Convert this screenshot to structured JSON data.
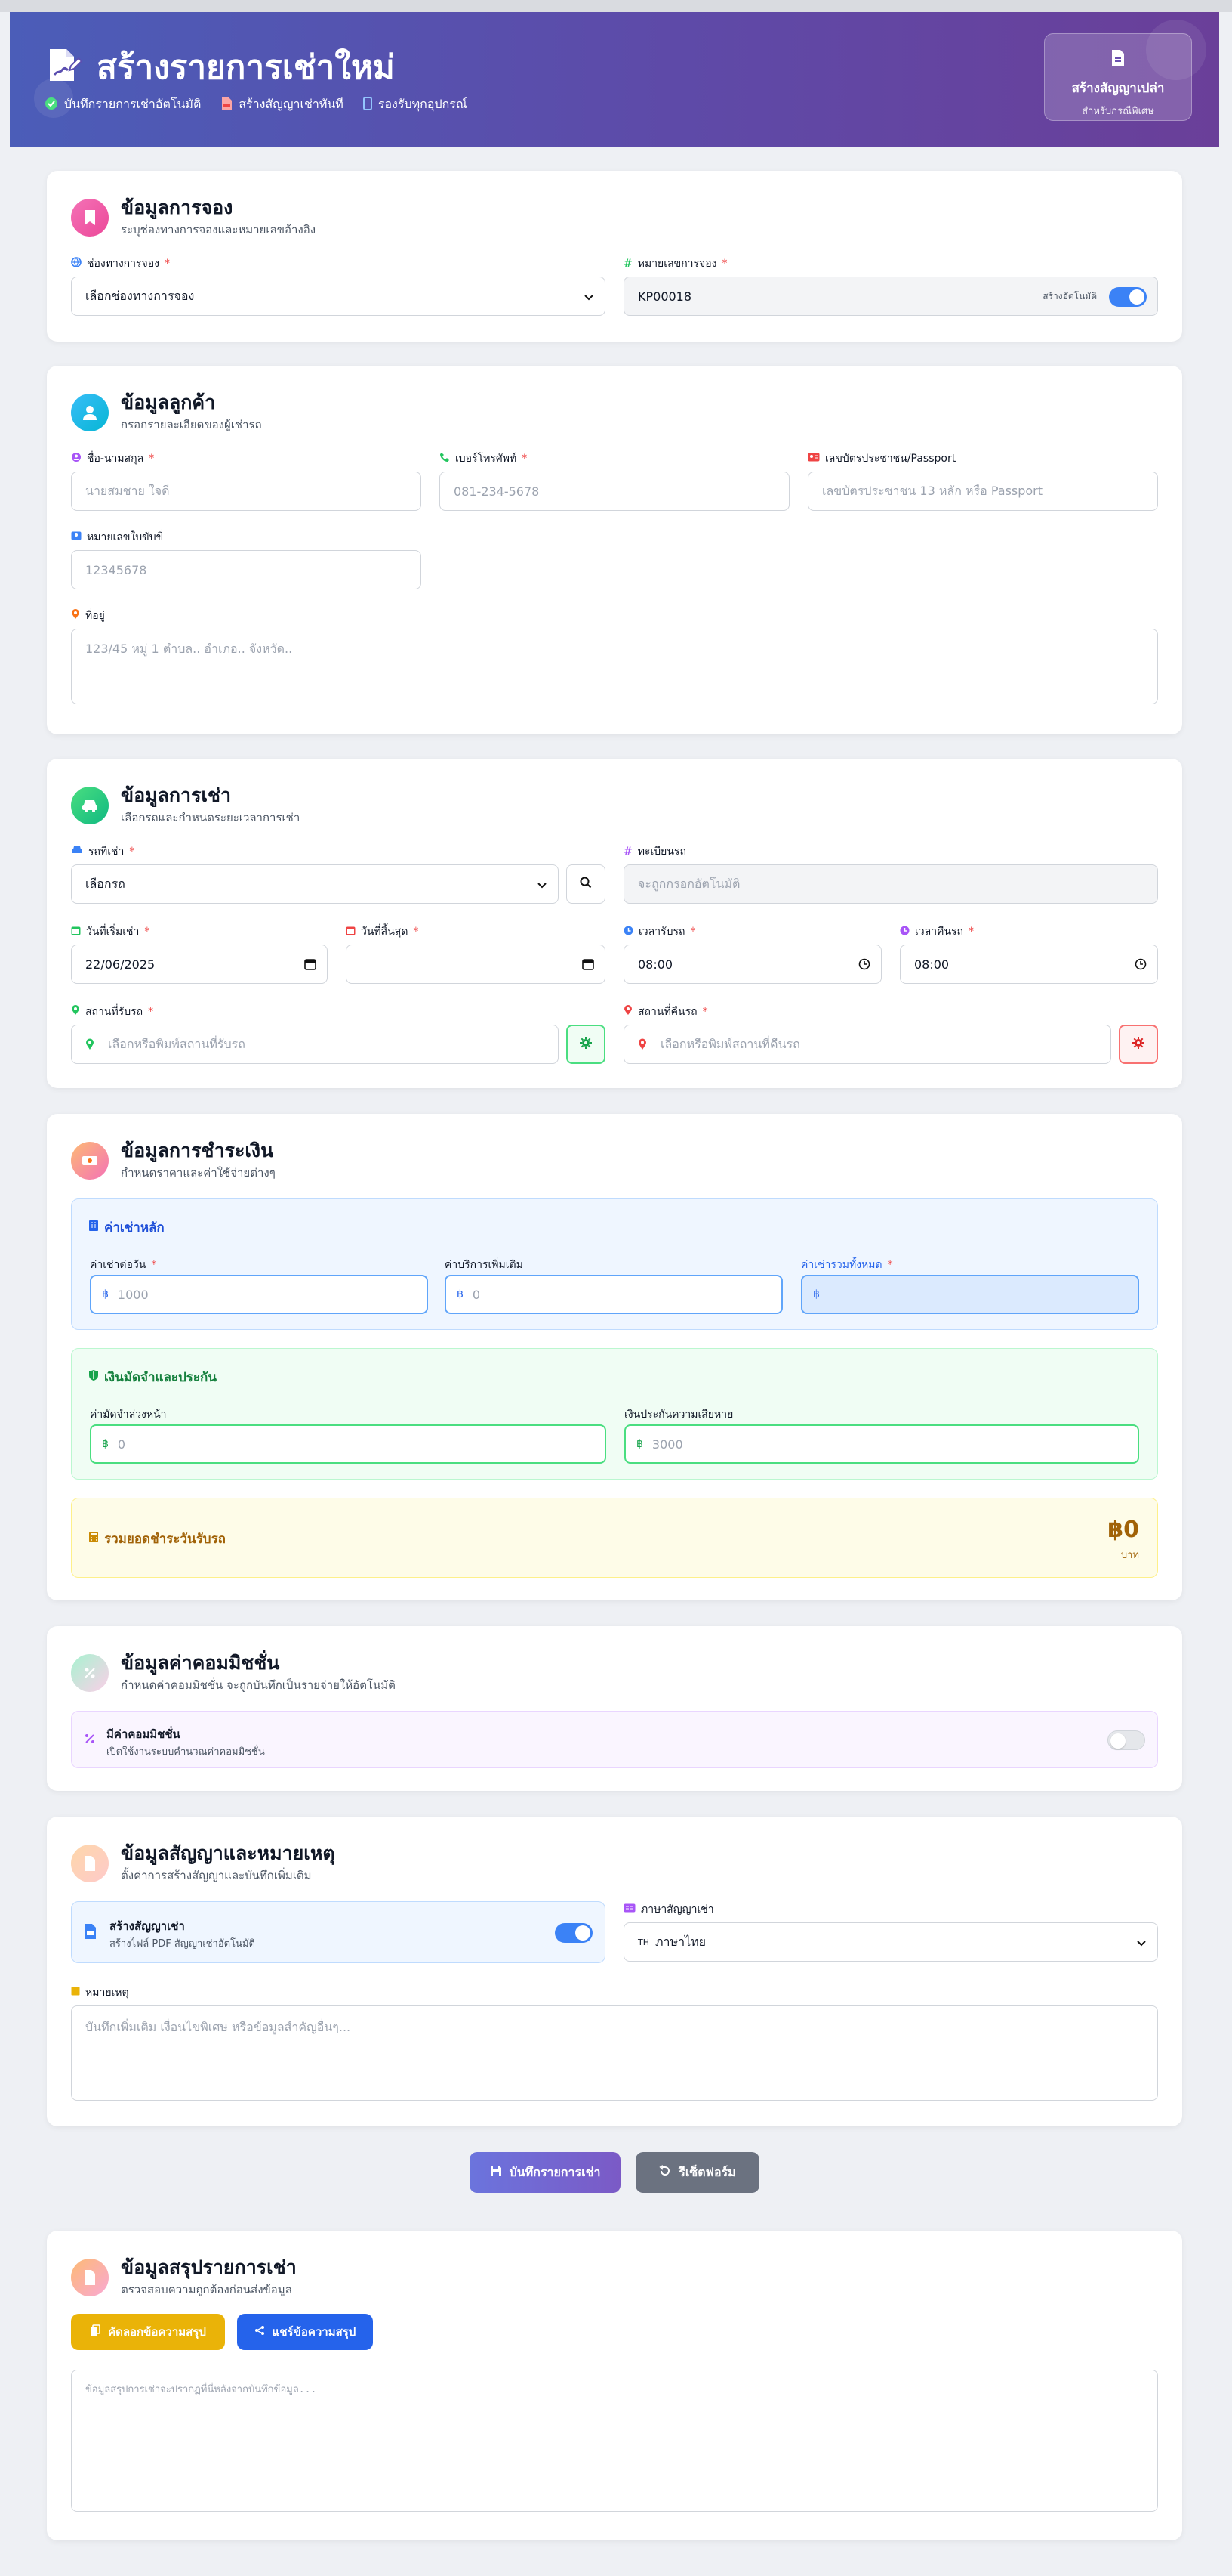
{
  "header": {
    "title": "สร้างรายการเช่าใหม่",
    "subs": [
      "บันทึกรายการเช่าอัตโนมัติ",
      "สร้างสัญญาเช่าทันที",
      "รองรับทุกอุปกรณ์"
    ],
    "blank_contract_title": "สร้างสัญญาเปล่า",
    "blank_contract_sub": "สำหรับกรณีพิเศษ"
  },
  "booking": {
    "title": "ข้อมูลการจอง",
    "subtitle": "ระบุช่องทางการจองและหมายเลขอ้างอิง",
    "channel_label": "ช่องทางการจอง",
    "channel_value": "เลือกช่องทางการจอง",
    "number_label": "หมายเลขการจอง",
    "number_value": "KP00018",
    "auto_label": "สร้างอัตโนมัติ"
  },
  "customer": {
    "title": "ข้อมูลลูกค้า",
    "subtitle": "กรอกรายละเอียดของผู้เช่ารถ",
    "name_label": "ชื่อ-นามสกุล",
    "name_placeholder": "นายสมชาย ใจดี",
    "phone_label": "เบอร์โทรศัพท์",
    "phone_placeholder": "081-234-5678",
    "id_label": "เลขบัตรประชาชน/Passport",
    "id_placeholder": "เลขบัตรประชาชน 13 หลัก หรือ Passport",
    "license_label": "หมายเลขใบขับขี่",
    "license_placeholder": "12345678",
    "address_label": "ที่อยู่",
    "address_placeholder": "123/45 หมู่ 1 ตำบล.. อำเภอ.. จังหวัด.."
  },
  "rental": {
    "title": "ข้อมูลการเช่า",
    "subtitle": "เลือกรถและกำหนดระยะเวลาการเช่า",
    "car_label": "รถที่เช่า",
    "car_value": "เลือกรถ",
    "plate_label": "ทะเบียนรถ",
    "plate_placeholder": "จะถูกกรอกอัตโนมัติ",
    "start_date_label": "วันที่เริ่มเช่า",
    "start_date_value": "22/06/2025",
    "end_date_label": "วันที่สิ้นสุด",
    "pickup_time_label": "เวลารับรถ",
    "pickup_time_value": "08:00",
    "return_time_label": "เวลาคืนรถ",
    "return_time_value": "08:00",
    "pickup_place_label": "สถานที่รับรถ",
    "pickup_place_placeholder": "เลือกหรือพิมพ์สถานที่รับรถ",
    "return_place_label": "สถานที่คืนรถ",
    "return_place_placeholder": "เลือกหรือพิมพ์สถานที่คืนรถ"
  },
  "payment": {
    "title": "ข้อมูลการชำระเงิน",
    "subtitle": "กำหนดราคาและค่าใช้จ่ายต่างๆ",
    "main_title": "ค่าเช่าหลัก",
    "daily_label": "ค่าเช่าต่อวัน",
    "daily_placeholder": "1000",
    "extra_label": "ค่าบริการเพิ่มเติม",
    "extra_placeholder": "0",
    "total_label": "ค่าเช่ารวมทั้งหมด",
    "baht_sign": "฿",
    "deposit_title": "เงินมัดจำและประกัน",
    "deposit_label": "ค่ามัดจำล่วงหน้า",
    "deposit_placeholder": "0",
    "insurance_label": "เงินประกันความเสียหาย",
    "insurance_placeholder": "3000",
    "sum_label": "รวมยอดชำระวันรับรถ",
    "sum_value": "฿0",
    "sum_unit": "บาท"
  },
  "commission": {
    "title": "ข้อมูลค่าคอมมิชชั่น",
    "subtitle": "กำหนดค่าคอมมิชชั่น จะถูกบันทึกเป็นรายจ่ายให้อัตโนมัติ",
    "toggle_title": "มีค่าคอมมิชชั่น",
    "toggle_sub": "เปิดใช้งานระบบคำนวณค่าคอมมิชชั่น",
    "enabled": false
  },
  "contract": {
    "title": "ข้อมูลสัญญาและหมายเหตุ",
    "subtitle": "ตั้งค่าการสร้างสัญญาและบันทึกเพิ่มเติม",
    "create_title": "สร้างสัญญาเช่า",
    "create_sub": "สร้างไฟล์ PDF สัญญาเช่าอัตโนมัติ",
    "create_enabled": true,
    "lang_label": "ภาษาสัญญาเช่า",
    "lang_value": "ภาษาไทย",
    "lang_flag": "TH",
    "note_label": "หมายเหตุ",
    "note_placeholder": "บันทึกเพิ่มเติม เงื่อนไขพิเศษ หรือข้อมูลสำคัญอื่นๆ..."
  },
  "actions": {
    "save_label": "บันทึกรายการเช่า",
    "reset_label": "รีเซ็ตฟอร์ม"
  },
  "summary": {
    "title": "ข้อมูลสรุปรายการเช่า",
    "subtitle": "ตรวจสอบความถูกต้องก่อนส่งข้อมูล",
    "copy_label": "คัดลอกข้อความสรุป",
    "share_label": "แชร์ข้อความสรุป",
    "text_placeholder": "ข้อมูลสรุปการเช่าจะปรากฏที่นี่หลังจากบันทึกข้อมูล..."
  },
  "colors": {
    "accent": "#4f6bd6",
    "pink": "#ec4899",
    "cyan": "#22c6e8",
    "green": "#34d399",
    "orange": "#fb923c",
    "purple": "#a855f7",
    "red": "#ef4444",
    "yellow": "#eab308",
    "blue_btn": "#2563eb"
  }
}
